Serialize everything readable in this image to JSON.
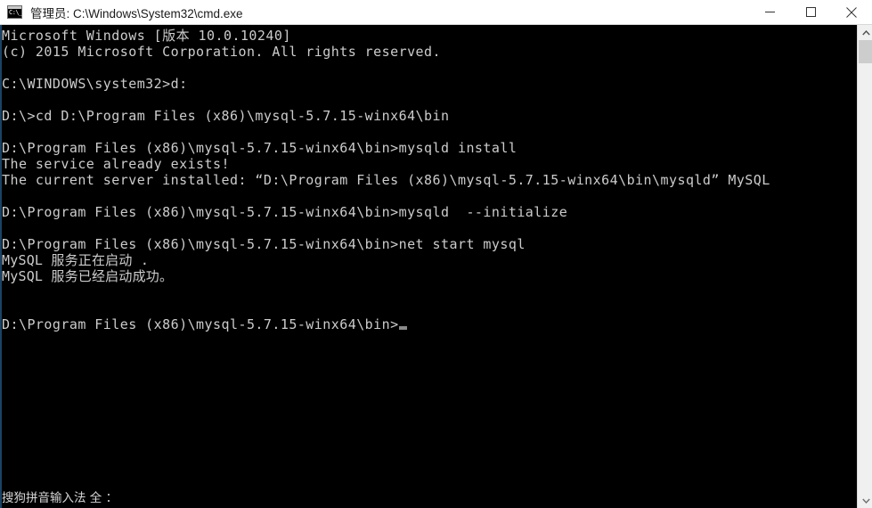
{
  "window": {
    "title": "管理员: C:\\Windows\\System32\\cmd.exe",
    "icon": "cmd-console-icon",
    "icon_glyph": "C:\\_",
    "background_color": "#000000",
    "titlebar_color": "#ffffff",
    "text_color": "#cccccc"
  },
  "titlebar_buttons": {
    "minimize_label": "minimize",
    "maximize_label": "maximize",
    "close_label": "close"
  },
  "console": {
    "lines": [
      "Microsoft Windows [版本 10.0.10240]",
      "(c) 2015 Microsoft Corporation. All rights reserved.",
      "",
      "C:\\WINDOWS\\system32>d:",
      "",
      "D:\\>cd D:\\Program Files (x86)\\mysql-5.7.15-winx64\\bin",
      "",
      "D:\\Program Files (x86)\\mysql-5.7.15-winx64\\bin>mysqld install",
      "The service already exists!",
      "The current server installed: “D:\\Program Files (x86)\\mysql-5.7.15-winx64\\bin\\mysqld” MySQL",
      "",
      "D:\\Program Files (x86)\\mysql-5.7.15-winx64\\bin>mysqld  --initialize",
      "",
      "D:\\Program Files (x86)\\mysql-5.7.15-winx64\\bin>net start mysql",
      "MySQL 服务正在启动 .",
      "MySQL 服务已经启动成功。",
      "",
      ""
    ],
    "prompt": "D:\\Program Files (x86)\\mysql-5.7.15-winx64\\bin>",
    "cursor": "_"
  },
  "ime": {
    "status_text": "搜狗拼音输入法 全 ："
  },
  "scrollbar": {
    "up_arrow": "scroll-up",
    "down_arrow": "scroll-down",
    "thumb_label": "scroll-thumb"
  }
}
